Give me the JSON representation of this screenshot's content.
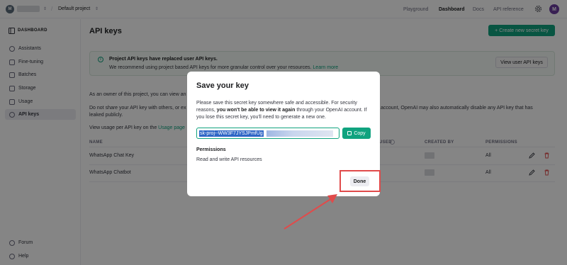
{
  "topbar": {
    "org_initial": "M",
    "project": "Default project",
    "nav": [
      "Playground",
      "Dashboard",
      "Docs",
      "API reference"
    ],
    "active_nav": "Dashboard",
    "user_initial": "M"
  },
  "sidebar": {
    "header": "DASHBOARD",
    "items": [
      {
        "label": "Assistants",
        "icon": "assistant-icon"
      },
      {
        "label": "Fine-tuning",
        "icon": "fine-tuning-icon"
      },
      {
        "label": "Batches",
        "icon": "batches-icon"
      },
      {
        "label": "Storage",
        "icon": "storage-icon"
      },
      {
        "label": "Usage",
        "icon": "usage-icon"
      },
      {
        "label": "API keys",
        "icon": "key-icon"
      }
    ],
    "footer": [
      {
        "label": "Forum",
        "icon": "forum-icon"
      },
      {
        "label": "Help",
        "icon": "help-icon"
      }
    ]
  },
  "main": {
    "title": "API keys",
    "create_button": "+ Create new secret key",
    "notice": {
      "title": "Project API keys have replaced user API keys.",
      "text": "We recommend using project based API keys for more granular control over your resources.",
      "link": "Learn more"
    },
    "view_user_keys_button": "View user API keys",
    "para1": "As an owner of this project, you can view an",
    "para2_left": "Do not share your API key with others, or ex",
    "para2_right": "account, OpenAI may also automatically disable any API key that has",
    "para2_line2": "leaked publicly.",
    "para3": "View usage per API key on the",
    "para3_link": "Usage page",
    "columns": [
      "NAME",
      "USED",
      "CREATED BY",
      "PERMISSIONS"
    ],
    "rows": [
      {
        "name": "WhatsApp Chat Key",
        "permissions": "All"
      },
      {
        "name": "WhatsApp Chatbot",
        "permissions": "All"
      }
    ]
  },
  "modal": {
    "title": "Save your key",
    "text_before": "Please save this secret key somewhere safe and accessible. For security reasons, ",
    "text_bold": "you won't be able to view it again",
    "text_after": " through your OpenAI account. If you lose this secret key, you'll need to generate a new one.",
    "key_value": "sk-proj--WW3F7JYSJPmfUg",
    "copy_button": "Copy",
    "permissions_label": "Permissions",
    "permissions_value": "Read and write API resources",
    "done_button": "Done"
  },
  "colors": {
    "accent": "#10a37f",
    "annotation": "#e04b4b",
    "selection": "#2f66c6"
  }
}
